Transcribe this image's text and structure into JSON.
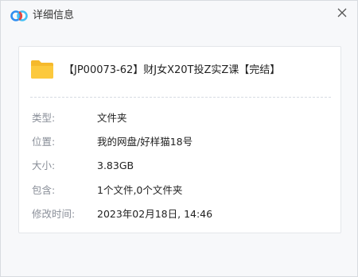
{
  "window": {
    "title": "详细信息",
    "accent_color": "#1e88e5"
  },
  "file": {
    "icon": "folder-icon",
    "name": "【JP00073-62】财J女X20T投Z实Z课【完结】"
  },
  "details": [
    {
      "label": "类型:",
      "value": "文件夹"
    },
    {
      "label": "位置:",
      "value": "我的网盘/好样猫18号"
    },
    {
      "label": "大小:",
      "value": "3.83GB"
    },
    {
      "label": "包含:",
      "value": "1个文件,0个文件夹"
    },
    {
      "label": "修改时间:",
      "value": "2023年02月18日, 14:46"
    }
  ]
}
